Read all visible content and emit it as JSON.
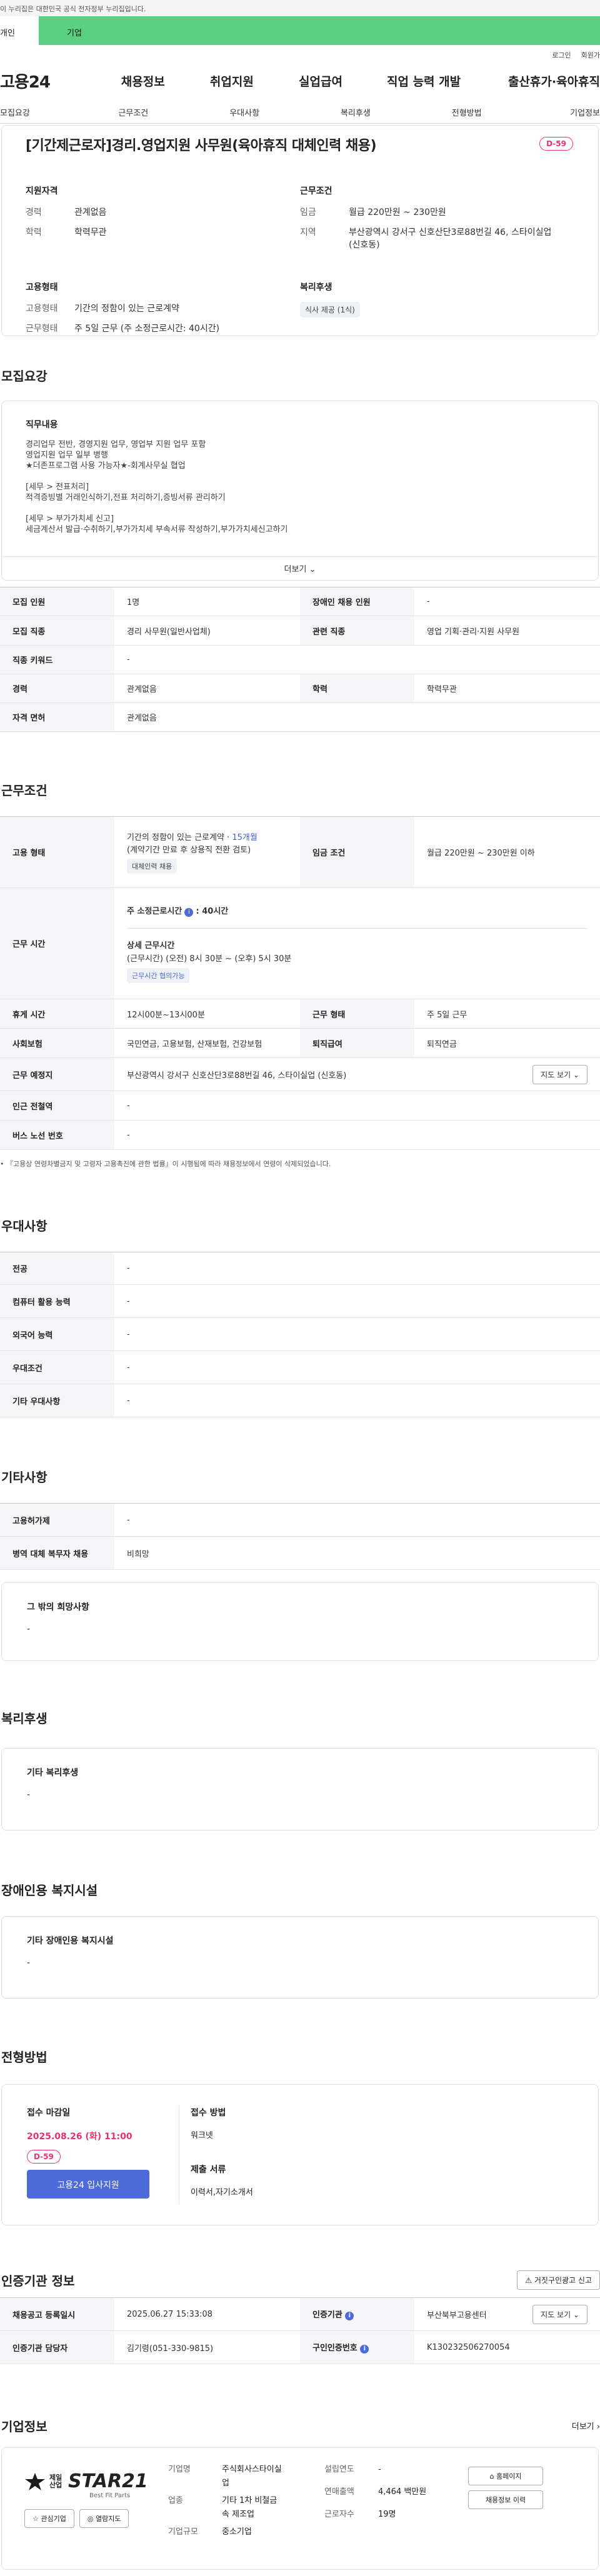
{
  "gov_banner": "이 누리집은 대한민국 공식 전자정부 누리집입니다.",
  "top_tabs": [
    "개인",
    "기업"
  ],
  "util": [
    "로그인",
    "회원가"
  ],
  "gnb": {
    "logo": "고용24",
    "menu": [
      "채용정보",
      "취업지원",
      "실업급여",
      "직업 능력 개발",
      "출산휴가·육아휴직"
    ]
  },
  "lnb": [
    "모집요강",
    "근무조건",
    "우대사항",
    "복리후생",
    "전형방법",
    "기업정보"
  ],
  "title": "[기간제근로자]경리.영업지원 사무원(육아휴직 대체인력 채용)",
  "dday": "D-59",
  "summary": {
    "qual_title": "지원자격",
    "cond_title": "근무조건",
    "type_title": "고용형태",
    "welfare_title": "복리후생",
    "career_k": "경력",
    "career_v": "관계없음",
    "edu_k": "학력",
    "edu_v": "학력무관",
    "wage_k": "임금",
    "wage_v": "월급 220만원 ~ 230만원",
    "loc_k": "지역",
    "loc_v1": "부산광역시 강서구 신호산단3로88번길 46, 스타이실업",
    "loc_v2": "(신호동)",
    "etype_k": "고용형태",
    "etype_v": "기간의 정함이 있는 근로계약",
    "wtype_k": "근무형태",
    "wtype_v": "주 5일 근무 (주 소정근로시간: 40시간)",
    "welfare_tag": "식사 제공 (1식)"
  },
  "recruit": {
    "title": "모집요강",
    "desc_head": "직무내용",
    "desc_lines": [
      "경리업무 전반, 경영지원 업무, 영업부 지원 업무 포함",
      "영업지원 업무 일부 병행",
      "★더존프로그램 사용 가능자★-회계사무실 협업",
      "",
      "[세무 > 전표처리]",
      "적격증빙별 거래인식하기,전표 처리하기,증빙서류 관리하기",
      "",
      "[세무 > 부가가치세 신고]",
      "세금계산서 발급·수취하기,부가가치세 부속서류 작성하기,부가가치세신고하기"
    ],
    "more": "더보기"
  },
  "recruit_table": [
    [
      "모집 인원",
      "1명",
      "장애인 채용 인원",
      "-"
    ],
    [
      "모집 직종",
      "경리 사무원(일반사업체)",
      "관련 직종",
      "영업 기획·관리·지원 사무원"
    ],
    [
      "직종 키워드",
      "-"
    ],
    [
      "경력",
      "관계없음",
      "학력",
      "학력무관"
    ],
    [
      "자격 면허",
      "관계없음"
    ]
  ],
  "conditions": {
    "title": "근무조건",
    "emp_type_h": "고용 형태",
    "emp_type_v1": "기간의 정함이 있는 근로계약 · ",
    "emp_type_months": "15개월",
    "emp_type_v2": "(계약기간 만료 후 상용직 전환 검토)",
    "emp_type_tag": "대체인력 채용",
    "wage_h": "임금 조건",
    "wage_v": "월급 220만원 ~ 230만원 이하",
    "hours_h": "근무 시간",
    "hours_v1": "주 소정근로시간",
    "hours_v1b": ": 40시간",
    "hours_detail": "상세 근무시간",
    "hours_v2": "(근무시간) (오전) 8시 30분 ~ (오후) 5시 30분",
    "hours_tag": "근무시간 협의가능",
    "rest_h": "휴게 시간",
    "rest_v": "12시00분~13시00분",
    "wform_h": "근무 형태",
    "wform_v": "주 5일 근무",
    "ins_h": "사회보험",
    "ins_v": "국민연금, 고용보험, 산재보험, 건강보험",
    "ret_h": "퇴직급여",
    "ret_v": "퇴직연금",
    "loc_h": "근무 예정지",
    "loc_v": "부산광역시 강서구 신호산단3로88번길 46, 스타이실업 (신호동)",
    "map_btn": "지도 보기",
    "sub_h": "인근 전철역",
    "sub_v": "-",
    "bus_h": "버스 노선 번호",
    "bus_v": "-",
    "note": "『고용상 연령차별금지 및 고령자 고용촉진에 관한 법률』이 시행됨에 따라 채용정보에서 연령이 삭제되었습니다."
  },
  "pref": {
    "title": "우대사항",
    "rows": [
      [
        "전공",
        "-"
      ],
      [
        "컴퓨터 활용 능력",
        "-"
      ],
      [
        "외국어 능력",
        "-"
      ],
      [
        "우대조건",
        "-"
      ],
      [
        "기타 우대사항",
        "-"
      ]
    ]
  },
  "etc": {
    "title": "기타사항",
    "rows": [
      [
        "고용허가제",
        "-"
      ],
      [
        "병역 대체 복무자 채용",
        "비희망"
      ]
    ],
    "wish_h": "그 밖의 희망사항",
    "wish_v": "-"
  },
  "welfare": {
    "title": "복리후생",
    "h": "기타 복리후생",
    "v": "-"
  },
  "disabled": {
    "title": "장애인용 복지시설",
    "h": "기타 장애인용 복지시설",
    "v": "-"
  },
  "selection": {
    "title": "전형방법",
    "deadline_h": "접수 마감일",
    "deadline_v": "2025.08.26 (화) 11:00",
    "dday": "D-59",
    "apply_btn": "고용24 입사지원",
    "method_h": "접수 방법",
    "method_v": "워크넷",
    "docs_h": "제출 서류",
    "docs_v": "이력서,자기소개서"
  },
  "agency": {
    "title": "인증기관 정보",
    "report_btn": "거짓구인광고 신고",
    "reg_h": "채용공고 등록일시",
    "reg_v": "2025.06.27 15:33:08",
    "org_h": "인증기관",
    "org_v": "부산북부고용센터",
    "map_btn": "지도 보기",
    "mgr_h": "인증기관 담당자",
    "mgr_v": "김기령(051-330-9815)",
    "id_h": "구인인증번호",
    "id_v": "K130232506270054"
  },
  "company": {
    "title": "기업정보",
    "more": "더보기",
    "logo_small": "제일 산업",
    "logo_big": "STAR21",
    "logo_sub": "Best Fit Parts",
    "btn1": "관심기업",
    "btn2": "열람지도",
    "ind_h": "기업명",
    "ind_v1": "주식회사스타이실",
    "ind_v2": "업",
    "biz_h": "업종",
    "biz_v1": "기타 1차 비철금",
    "biz_v2": "속 제조업",
    "size_h": "기업규모",
    "size_v": "중소기업",
    "est_h": "설립연도",
    "est_v": "-",
    "sales_h": "연매출액",
    "sales_v": "4,464 백만원",
    "emp_h": "근로자수",
    "emp_v": "19명",
    "home_btn": "홈페이지",
    "list_btn": "채용정보 이력"
  },
  "colors": {
    "accent": "#5bcf82",
    "dday": "#e8306f",
    "apply": "#4c6ad8"
  }
}
